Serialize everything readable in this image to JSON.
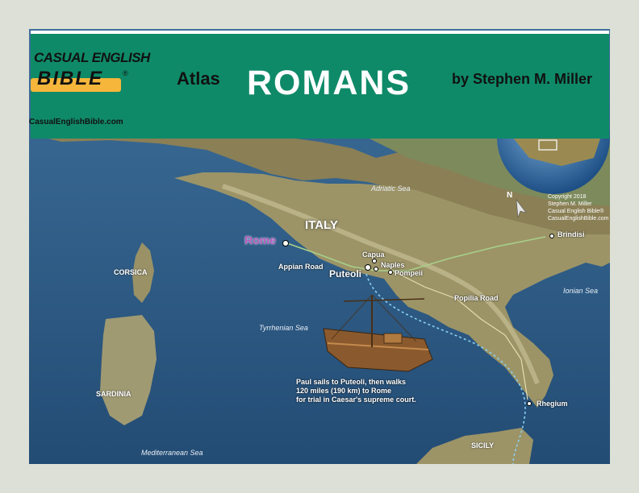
{
  "header": {
    "brand_line1": "CASUAL ENGLISH",
    "brand_line2": "BIBLE",
    "brand_reg": "®",
    "brand_url": "CasualEnglishBible.com",
    "atlas": "Atlas",
    "title": "ROMANS",
    "author": "by Stephen M. Miller"
  },
  "map": {
    "seas": {
      "adriatic": "Adriatic Sea",
      "tyrrhenian": "Tyrrhenian Sea",
      "ionian": "Ionian Sea",
      "mediterranean": "Mediterranean Sea"
    },
    "regions": {
      "italy": "ITALY",
      "corsica": "CORSICA",
      "sardinia": "SARDINIA",
      "sicily": "SICILY"
    },
    "cities": {
      "rome": "Rome",
      "capua": "Capua",
      "naples": "Naples",
      "pompeii": "Pompeii",
      "puteoli": "Puteoli",
      "brindisi": "Brindisi",
      "rhegium": "Rhegium"
    },
    "roads": {
      "appian": "Appian Road",
      "popilia": "Popilia Road"
    },
    "north": "N",
    "caption": [
      "Paul sails to Puteoli, then walks",
      "120 miles (190 km) to Rome",
      "for trial in Caesar's supreme court."
    ],
    "copyright": [
      "Copyright 2018",
      "Stephen M. Miller",
      "Casual English Bible®",
      "CasualEnglishBible.com"
    ],
    "colors": {
      "sea": "#2c5a86",
      "land": "#8f8a5a",
      "header": "#0f8a68",
      "rome_label": "#b45cc0",
      "brand_accent": "#f5b63b"
    }
  }
}
